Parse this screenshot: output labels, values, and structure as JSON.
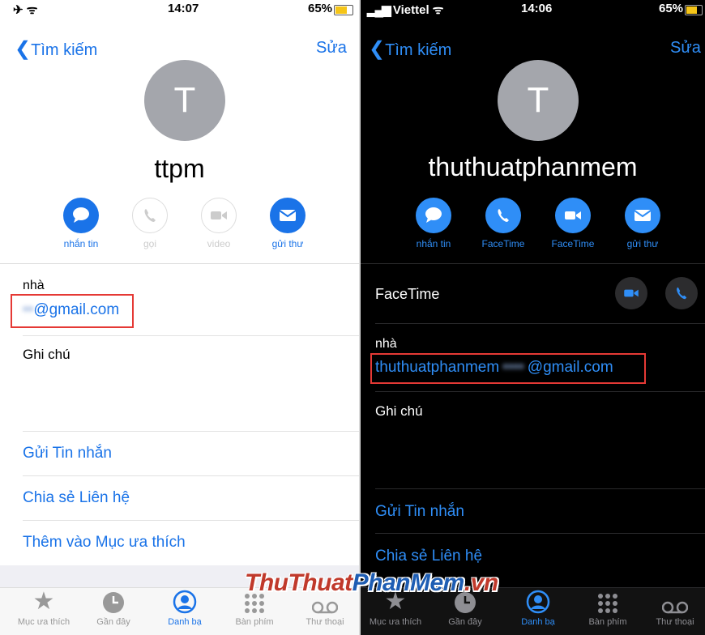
{
  "left": {
    "status": {
      "time": "14:07",
      "battery": "65%"
    },
    "nav": {
      "back": "Tìm kiếm",
      "edit": "Sửa"
    },
    "avatar_initial": "T",
    "name": "ttpm",
    "actions": [
      {
        "label": "nhắn tin",
        "icon": "message-icon",
        "enabled": true
      },
      {
        "label": "gọi",
        "icon": "phone-icon",
        "enabled": false
      },
      {
        "label": "video",
        "icon": "video-icon",
        "enabled": false
      },
      {
        "label": "gửi thư",
        "icon": "mail-icon",
        "enabled": true
      }
    ],
    "email_label": "nhà",
    "email_value": "@gmail.com",
    "notes_label": "Ghi chú",
    "menu": [
      "Gửi Tin nhắn",
      "Chia sẻ Liên hệ",
      "Thêm vào Mục ưa thích"
    ],
    "tabs": [
      "Mục ưa thích",
      "Gần đây",
      "Danh bạ",
      "Bàn phím",
      "Thư thoại"
    ]
  },
  "right": {
    "status": {
      "carrier": "Viettel",
      "time": "14:06",
      "battery": "65%"
    },
    "nav": {
      "back": "Tìm kiếm",
      "edit": "Sửa"
    },
    "avatar_initial": "T",
    "name": "thuthuatphanmem",
    "actions": [
      {
        "label": "nhắn tin",
        "icon": "message-icon"
      },
      {
        "label": "FaceTime",
        "icon": "phone-icon"
      },
      {
        "label": "FaceTime",
        "icon": "video-icon"
      },
      {
        "label": "gửi thư",
        "icon": "mail-icon"
      }
    ],
    "facetime_label": "FaceTime",
    "email_label": "nhà",
    "email_value_prefix": "thuthuatphanmem",
    "email_value_suffix": "@gmail.com",
    "notes_label": "Ghi chú",
    "menu": [
      "Gửi Tin nhắn",
      "Chia sẻ Liên hệ"
    ],
    "tabs": [
      "Mục ưa thích",
      "Gần đây",
      "Danh bạ",
      "Bàn phím",
      "Thư thoại"
    ]
  },
  "watermark": {
    "part1": "ThuThuat",
    "part2": "PhanMem",
    "part3": ".vn"
  },
  "colors": {
    "accent": "#1a73e8",
    "highlight": "#e53935",
    "avatar_gray": "#a4a6ac",
    "dark_bg": "#000000"
  }
}
